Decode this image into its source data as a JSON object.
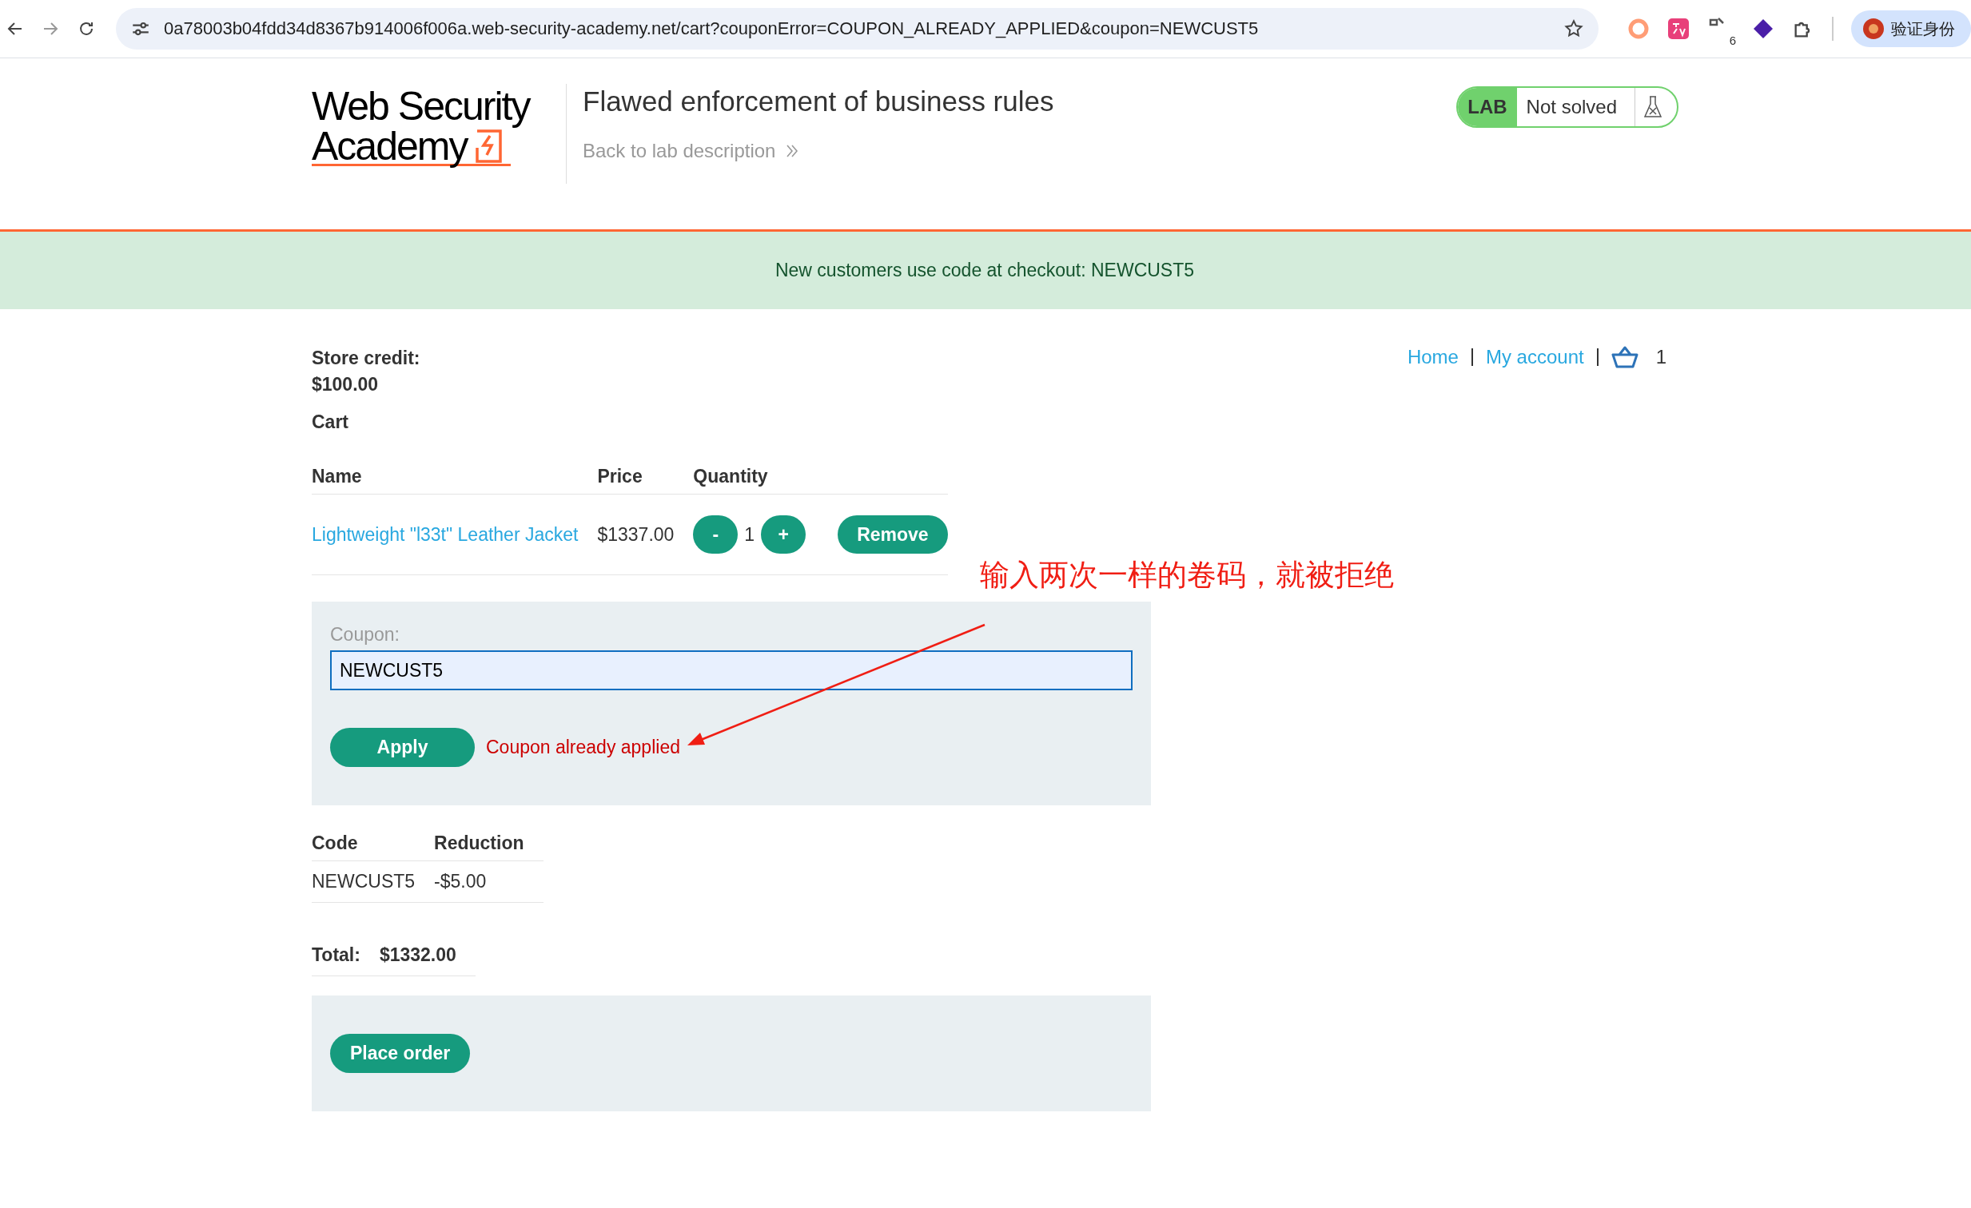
{
  "browser": {
    "url": "0a78003b04fdd34d8367b914006f006a.web-security-academy.net/cart?couponError=COUPON_ALREADY_APPLIED&coupon=NEWCUST5",
    "extension_badge": "6",
    "profile_label": "验证身份"
  },
  "header": {
    "logo_lines": [
      "Web Security",
      "Academy"
    ],
    "title": "Flawed enforcement of business rules",
    "back_link": "Back to lab description",
    "lab_badge": "LAB",
    "lab_status": "Not solved"
  },
  "banner": "New customers use code at checkout: NEWCUST5",
  "store_credit": {
    "label": "Store credit:",
    "amount": "$100.00"
  },
  "nav": {
    "links": [
      "Home",
      "My account"
    ],
    "cart_count": "1"
  },
  "cart": {
    "heading": "Cart",
    "columns": [
      "Name",
      "Price",
      "Quantity"
    ],
    "items": [
      {
        "name": "Lightweight \"l33t\" Leather Jacket",
        "price": "$1337.00",
        "decrement": "-",
        "quantity": "1",
        "increment": "+",
        "remove": "Remove"
      }
    ]
  },
  "coupon": {
    "label": "Coupon:",
    "value": "NEWCUST5",
    "apply": "Apply",
    "error": "Coupon already applied"
  },
  "reductions": {
    "columns": [
      "Code",
      "Reduction"
    ],
    "rows": [
      {
        "code": "NEWCUST5",
        "reduction": "-$5.00"
      }
    ]
  },
  "total": {
    "label": "Total:",
    "amount": "$1332.00"
  },
  "place_order": "Place order",
  "annotation": {
    "text": "输入两次一样的卷码，就被拒绝"
  }
}
